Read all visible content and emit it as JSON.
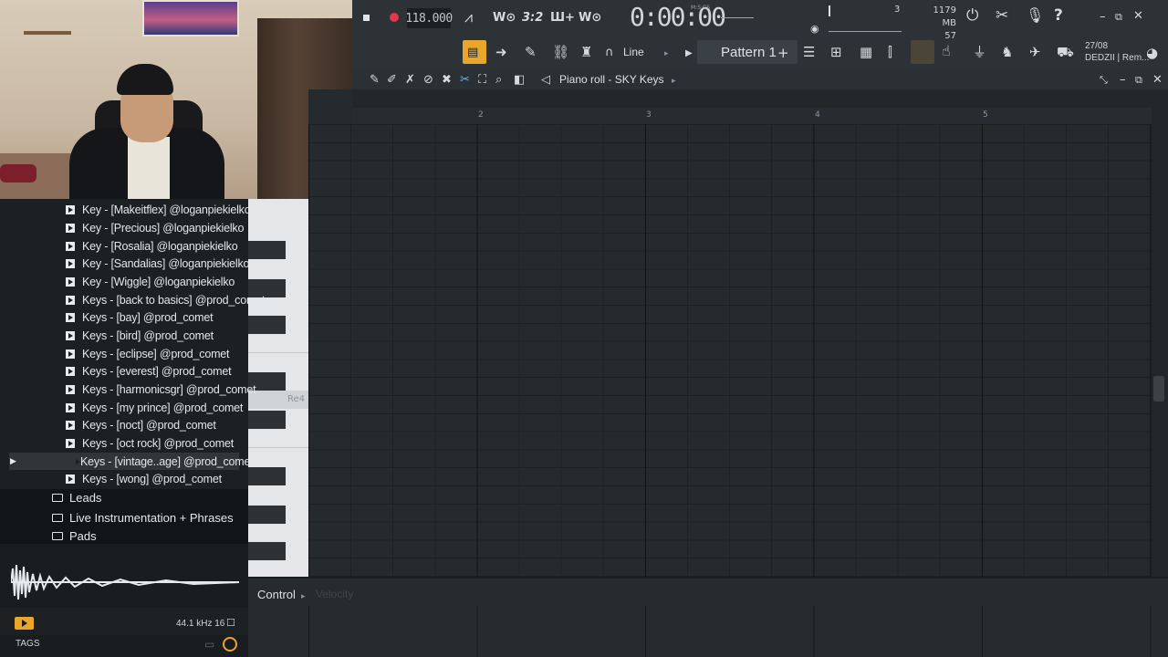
{
  "transport": {
    "tempo": "118.000",
    "time": "0:00:00",
    "time_unit": "M:S:CS",
    "pattern_step": "3",
    "memory": "1179 MB",
    "polyphony": "57"
  },
  "toolbar": {
    "snap_mode": "Line",
    "pattern": "Pattern 1",
    "pattern_add": "+",
    "hint_date": "27/08",
    "hint_text": "DEDZII | Rem..."
  },
  "piano_roll": {
    "title": "Piano roll - SKY Keys",
    "bars": [
      "2",
      "3",
      "4",
      "5"
    ],
    "key_label": "Re4",
    "control_label": "Control",
    "control_target": "Velocity"
  },
  "browser": {
    "items": [
      "Key - [Makeitflex] @loganpiekielko",
      "Key - [Precious] @loganpiekielko",
      "Key - [Rosalia] @loganpiekielko",
      "Key - [Sandalias] @loganpiekielko",
      "Key - [Wiggle] @loganpiekielko",
      "Keys - [back to basics] @prod_comet",
      "Keys - [bay] @prod_comet",
      "Keys - [bird] @prod_comet",
      "Keys - [eclipse] @prod_comet",
      "Keys - [everest] @prod_comet",
      "Keys - [harmonicsgr] @prod_comet",
      "Keys - [my prince] @prod_comet",
      "Keys - [noct] @prod_comet",
      "Keys - [oct rock] @prod_comet",
      "Keys - [vintage..age] @prod_comet",
      "Keys - [wong] @prod_comet"
    ],
    "selected_index": 14,
    "folders": [
      "Leads",
      "Live Instrumentation + Phrases",
      "Pads"
    ],
    "sample_rate": "44.1 kHz 16",
    "tags_label": "TAGS"
  },
  "colors": {
    "accent": "#e8a62b",
    "record": "#e3374a",
    "background": "#1f2326"
  },
  "icons": [
    "stop-icon",
    "record-icon",
    "metronome-icon",
    "loop-icon",
    "pattern-icon",
    "pencil-icon",
    "paint-icon",
    "delete-icon",
    "mute-icon",
    "slice-icon",
    "select-icon",
    "zoom-icon",
    "play-icon",
    "speaker-icon",
    "search-icon",
    "close-icon",
    "minimize-icon",
    "maximize-icon"
  ]
}
